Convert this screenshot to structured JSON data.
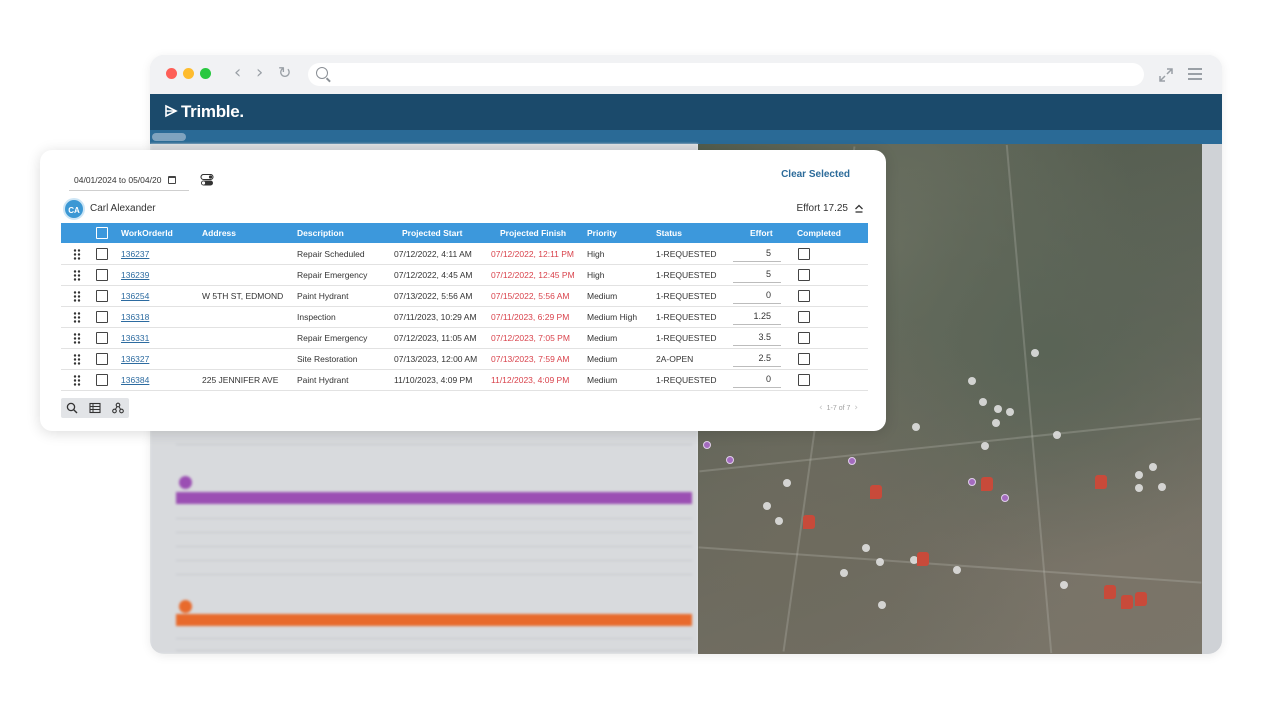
{
  "app": {
    "brand": "Trimble."
  },
  "toolbar": {
    "date_range": "04/01/2024 to 05/04/20",
    "clear_selected": "Clear Selected"
  },
  "user": {
    "initials": "CA",
    "name": "Carl Alexander",
    "effort_total": "Effort 17.25"
  },
  "grid": {
    "columns": [
      "WorkOrderId",
      "Address",
      "Description",
      "Projected Start",
      "Projected Finish",
      "Priority",
      "Status",
      "Effort",
      "Completed"
    ],
    "rows": [
      {
        "id": "136237",
        "address": "",
        "description": "Repair Scheduled",
        "start": "07/12/2022, 4:11 AM",
        "finish": "07/12/2022, 12:11 PM",
        "priority": "High",
        "status": "1-REQUESTED",
        "effort": "5"
      },
      {
        "id": "136239",
        "address": "",
        "description": "Repair Emergency",
        "start": "07/12/2022, 4:45 AM",
        "finish": "07/12/2022, 12:45 PM",
        "priority": "High",
        "status": "1-REQUESTED",
        "effort": "5"
      },
      {
        "id": "136254",
        "address": "W 5TH ST, EDMOND",
        "description": "Paint Hydrant",
        "start": "07/13/2022, 5:56 AM",
        "finish": "07/15/2022, 5:56 AM",
        "priority": "Medium",
        "status": "1-REQUESTED",
        "effort": "0"
      },
      {
        "id": "136318",
        "address": "",
        "description": "Inspection",
        "start": "07/11/2023, 10:29 AM",
        "finish": "07/11/2023, 6:29 PM",
        "priority": "Medium High",
        "status": "1-REQUESTED",
        "effort": "1.25"
      },
      {
        "id": "136331",
        "address": "",
        "description": "Repair Emergency",
        "start": "07/12/2023, 11:05 AM",
        "finish": "07/12/2023, 7:05 PM",
        "priority": "Medium",
        "status": "1-REQUESTED",
        "effort": "3.5"
      },
      {
        "id": "136327",
        "address": "",
        "description": "Site Restoration",
        "start": "07/13/2023, 12:00 AM",
        "finish": "07/13/2023, 7:59 AM",
        "priority": "Medium",
        "status": "2A-OPEN",
        "effort": "2.5"
      },
      {
        "id": "136384",
        "address": "225 JENNIFER AVE",
        "description": "Paint Hydrant",
        "start": "11/10/2023, 4:09 PM",
        "finish": "11/12/2023, 4:09 PM",
        "priority": "Medium",
        "status": "1-REQUESTED",
        "effort": "0"
      }
    ]
  },
  "pager": {
    "label": "1-7 of 7"
  },
  "colors": {
    "header_blue": "#3c98dc",
    "brand_navy": "#1b4a6b",
    "finish_red": "#d9434c",
    "link_blue": "#2c6ba0",
    "group_purple": "#9b4fb3",
    "group_orange": "#e86a2c"
  },
  "icons": [
    "search-icon",
    "grid-view-icon",
    "route-icon",
    "calendar-icon",
    "toggle-icon",
    "collapse-icon",
    "drag-handle-icon"
  ]
}
